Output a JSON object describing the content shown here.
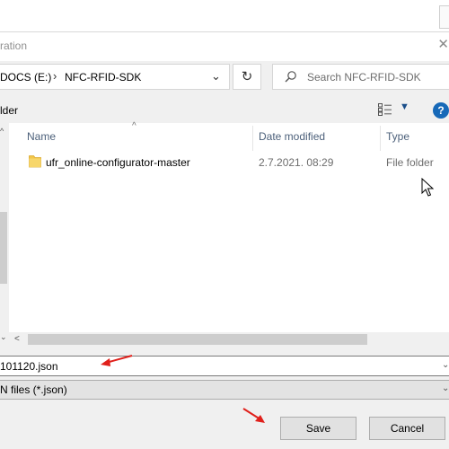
{
  "window": {
    "title": "ration",
    "close_glyph": "✕"
  },
  "address": {
    "root": "DOCS (E:)",
    "separator": "›",
    "folder": "NFC-RFID-SDK",
    "dropdown_glyph": "⌄",
    "refresh_glyph": "↻"
  },
  "search": {
    "placeholder": "Search NFC-RFID-SDK",
    "icon": "search-icon"
  },
  "toolbar": {
    "folder_label": "lder",
    "view_dropdown_glyph": "▼",
    "help_glyph": "?"
  },
  "columns": {
    "sort_glyph": "^",
    "name": "Name",
    "date": "Date modified",
    "type": "Type"
  },
  "files": [
    {
      "name": "ufr_online-configurator-master",
      "date": "2.7.2021. 08:29",
      "type": "File folder",
      "icon": "folder-icon"
    }
  ],
  "filename": {
    "value": "101120.json",
    "dropdown_glyph": "⌄"
  },
  "filetype": {
    "value": "N files (*.json)",
    "dropdown_glyph": "⌄"
  },
  "buttons": {
    "save": "Save",
    "cancel": "Cancel"
  },
  "scroll_glyphs": {
    "up": "^",
    "down": "⌄",
    "left": "<"
  },
  "colors": {
    "accent": "#1769b8",
    "folder": "#f3c74a",
    "annotation": "#e0201b"
  }
}
